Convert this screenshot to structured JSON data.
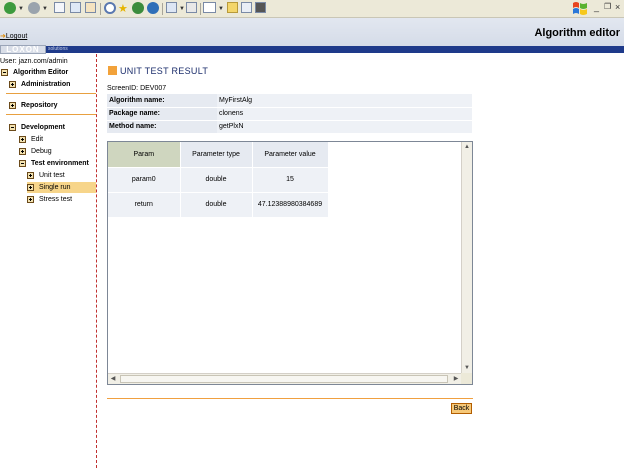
{
  "browser": {
    "icons": [
      "back-icon",
      "forward-icon",
      "stop-icon",
      "refresh-icon",
      "home-icon",
      "search-icon",
      "favorites-icon",
      "media-icon",
      "history-icon",
      "mail-icon",
      "print-icon",
      "edit-icon",
      "folder-icon",
      "messenger-icon"
    ]
  },
  "header": {
    "logout_label": "Logout",
    "app_title": "Algorithm editor",
    "logo_text": "LOXON",
    "logo_sub": "solutions"
  },
  "sidebar": {
    "user": "User: jazn.com/admin",
    "root": "Algorithm Editor",
    "administration": "Administration",
    "repository": "Repository",
    "development": "Development",
    "edit": "Edit",
    "debug": "Debug",
    "test_environment": "Test environment",
    "unit_test": "Unit test",
    "single_run": "Single run",
    "stress_test": "Stress test"
  },
  "main": {
    "title": "UNIT TEST RESULT",
    "screen_id": "ScreenID: DEV007",
    "info": [
      {
        "label": "Algorithm name:",
        "value": "MyFirstAlg"
      },
      {
        "label": "Package name:",
        "value": "clonens"
      },
      {
        "label": "Method name:",
        "value": "getPlxN"
      }
    ],
    "table": {
      "headers": [
        "Param",
        "Parameter type",
        "Parameter value"
      ],
      "rows": [
        [
          "param0",
          "double",
          "15"
        ],
        [
          "return",
          "double",
          "47.12388980384689"
        ]
      ]
    },
    "back_label": "Back"
  },
  "colors": {
    "accent": "#f2a23a",
    "stripe": "#1e3a8a",
    "title_blue": "#1b2d6b"
  }
}
